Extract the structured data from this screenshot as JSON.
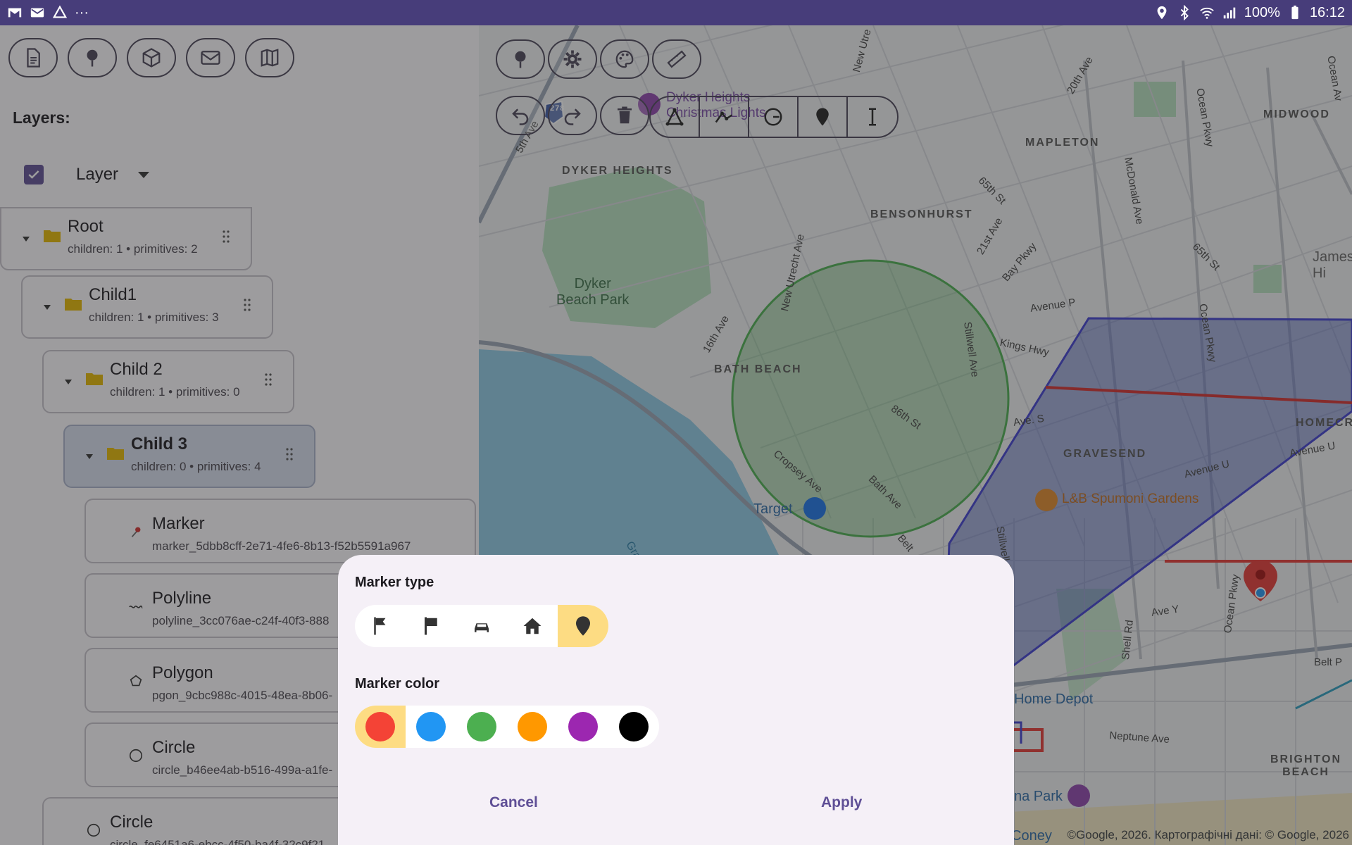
{
  "status_bar": {
    "battery": "100%",
    "time": "16:12",
    "more": "···"
  },
  "left_panel": {
    "layers_title": "Layers:",
    "layer_select": {
      "value": "Layer"
    },
    "tree": [
      {
        "title": "Root",
        "subtitle": "children: 1 • primitives: 2"
      },
      {
        "title": "Child1",
        "subtitle": "children: 1 • primitives: 3"
      },
      {
        "title": "Child 2",
        "subtitle": "children: 1 • primitives: 0"
      },
      {
        "title": "Child 3",
        "subtitle": "children: 0 • primitives: 4"
      }
    ],
    "primitives": [
      {
        "title": "Marker",
        "subtitle": "marker_5dbb8cff-2e71-4fe6-8b13-f52b5591a967"
      },
      {
        "title": "Polyline",
        "subtitle": "polyline_3cc076ae-c24f-40f3-888"
      },
      {
        "title": "Polygon",
        "subtitle": "pgon_9cbc988c-4015-48ea-8b06-"
      },
      {
        "title": "Circle",
        "subtitle": "circle_b46ee4ab-b516-499a-a1fe-"
      },
      {
        "title": "Circle",
        "subtitle": "circle_fe6451a6-ebcc-4f50-ba4f-32c9f21"
      }
    ]
  },
  "map": {
    "labels": {
      "dyker_heights": "DYKER HEIGHTS",
      "bensonhurst": "BENSONHURST",
      "mapleton": "MAPLETON",
      "midwood": "MIDWOOD",
      "bath_beach": "BATH BEACH",
      "gravesend": "GRAVESEND",
      "homecrest": "HOMECR",
      "brighton_beach": "BRIGHTON\nBEACH",
      "dyker_beach_park": "Dyker\nBeach Park",
      "target": "Target",
      "lb_spumoni": "L&B Spumoni Gardens",
      "home_depot": "Home Depot",
      "luna_park": "na Park",
      "coney": "Coney",
      "dyker_lights": "Dyker Heights\nChristmas Lights",
      "gravesend_bay": "Gravesend Bay",
      "james": "James\nHi",
      "interstate": "278",
      "streets": {
        "s1": "5th Ave",
        "s2": "16th Ave",
        "s3": "New Utrecht Ave",
        "s4": "Cropsey Ave",
        "s5": "Bath Ave",
        "s6": "86th St",
        "s7": "Stillwell Ave",
        "s8": "Kings Hwy",
        "s9": "Avenue P",
        "s10": "Ave. S",
        "s11": "Avenue U",
        "s12": "Ave Y",
        "s13": "Neptune Ave",
        "s14": "Belt P",
        "s15": "Shell Rd",
        "s16": "Ocean Pkwy",
        "s17": "McDonald Ave",
        "s18": "65th St",
        "s19": "21st Ave",
        "s20": "Bay Pkwy",
        "s21": "20th Ave",
        "s22": "Avenue U",
        "s23": "New Utre",
        "s24": "Ocean Av",
        "s25": "Belt",
        "s26": "Stillwell Ave",
        "s27": "Ocean Pkwy",
        "s28": "Ocean Pkwy",
        "s29": "65th St"
      }
    },
    "attribution": "©Google, 2026. Картографічні дані: © Google, 2026"
  },
  "sheet": {
    "marker_type_label": "Marker type",
    "marker_color_label": "Marker color",
    "colors": [
      "#f44336",
      "#2196f3",
      "#4caf50",
      "#ff9800",
      "#9c27b0",
      "#000000"
    ],
    "selected_color": "#f44336",
    "cancel": "Cancel",
    "apply": "Apply"
  }
}
